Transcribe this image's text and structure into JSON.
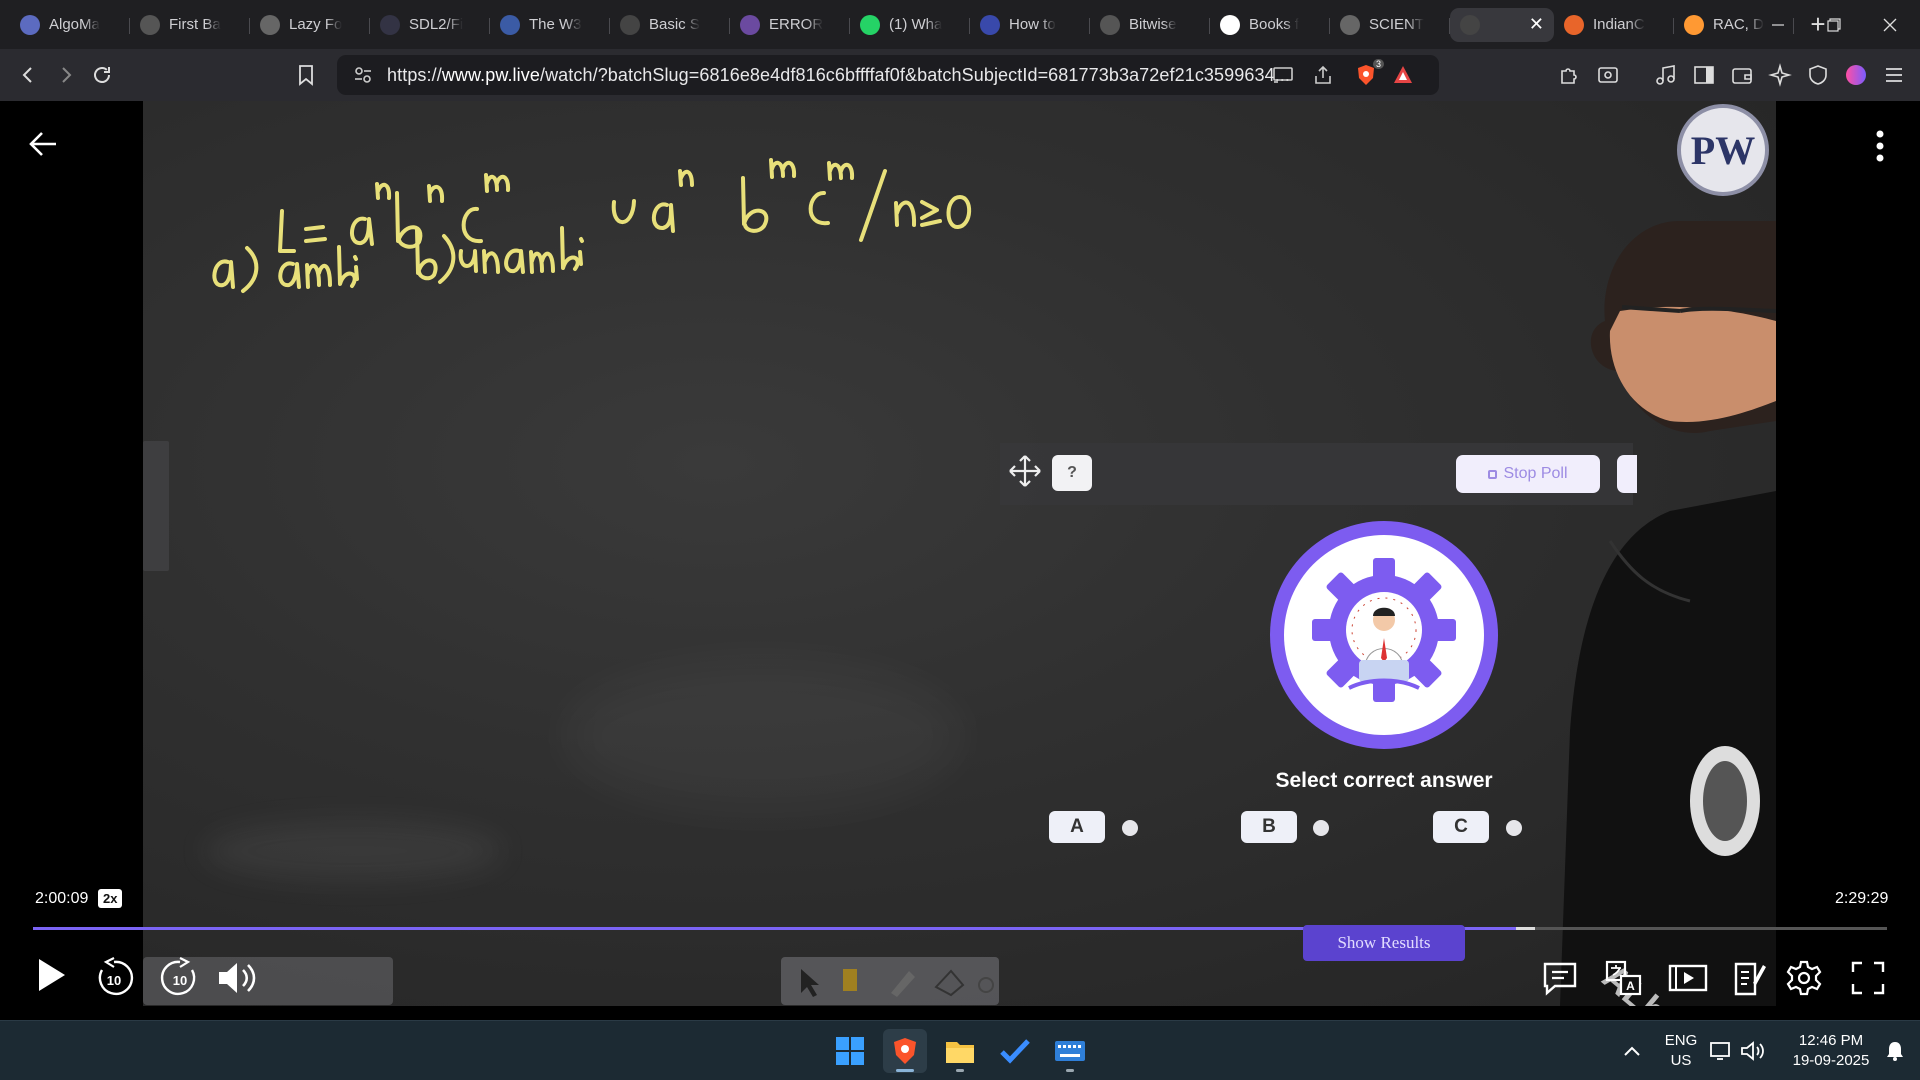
{
  "browser": {
    "tabs": [
      {
        "title": "AlgoMa",
        "icon": "algomaster-icon",
        "color": "#5c6bc0"
      },
      {
        "title": "First Ba",
        "icon": "rupee-icon",
        "color": "#555"
      },
      {
        "title": "Lazy Fo",
        "icon": "globe-icon",
        "color": "#666"
      },
      {
        "title": "SDL2/Fi",
        "icon": "sdl-icon",
        "color": "#334"
      },
      {
        "title": "The W3",
        "icon": "w3-icon",
        "color": "#3b5ba5"
      },
      {
        "title": "Basic S",
        "icon": "doc-icon",
        "color": "#444"
      },
      {
        "title": "ERROR",
        "icon": "error-icon",
        "color": "#6b4aa0"
      },
      {
        "title": "(1) Wha",
        "icon": "whatsapp-icon",
        "color": "#25d366"
      },
      {
        "title": "How to",
        "icon": "bookmark-icon",
        "color": "#3949ab"
      },
      {
        "title": "Bitwise",
        "icon": "code-icon",
        "color": "#555"
      },
      {
        "title": "Books f",
        "icon": "google-icon",
        "color": "#fff"
      },
      {
        "title": "SCIENT",
        "icon": "globe-icon",
        "color": "#666"
      },
      {
        "title": "",
        "icon": "pw-icon",
        "color": "#444",
        "active": true
      },
      {
        "title": "IndianC",
        "icon": "flag-icon",
        "color": "#e8652a"
      },
      {
        "title": "RAC, D",
        "icon": "india-flag-icon",
        "color": "#ff9933"
      }
    ],
    "url_prefix": "https://",
    "url_host": "www.pw.live",
    "url_rest": "/watch/?batchSlug=6816e8e4df816c6bffffaf0f&batchSubjectId=681773b3a72ef21c3599634...",
    "brave_badge": "3"
  },
  "video": {
    "elapsed": "2:00:09",
    "speed": "2x",
    "duration": "2:29:29",
    "progress_fraction": 0.8,
    "buffered_fraction": 0.81,
    "board": {
      "line1": "L = aⁿbⁿcᵐ ∪ aⁿbᵐcᵐ / n≥0",
      "line2": "a) ambi   b) unambi"
    },
    "poll": {
      "stop_label": "Stop Poll",
      "question_icon": "?",
      "prompt": "Select correct answer",
      "options": [
        "A",
        "B",
        "C"
      ]
    },
    "show_results_label": "Show Results",
    "logo_text": "PW"
  },
  "taskbar": {
    "lang_top": "ENG",
    "lang_bottom": "US",
    "time": "12:46 PM",
    "date": "19-09-2025"
  }
}
